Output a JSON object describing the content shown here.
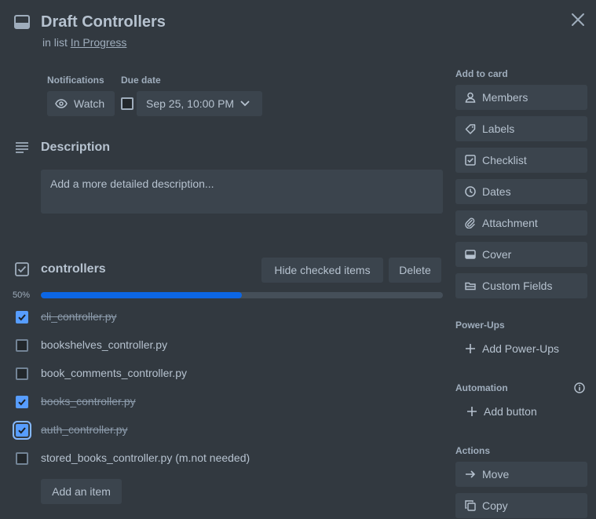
{
  "card": {
    "title": "Draft Controllers",
    "in_list_prefix": "in list",
    "list_name": "In Progress"
  },
  "notifications": {
    "label": "Notifications",
    "watch_label": "Watch"
  },
  "due_date": {
    "label": "Due date",
    "value": "Sep 25, 10:00 PM",
    "checked": false
  },
  "description": {
    "title": "Description",
    "placeholder": "Add a more detailed description..."
  },
  "checklist": {
    "title": "controllers",
    "hide_checked_label": "Hide checked items",
    "delete_label": "Delete",
    "progress_label": "50%",
    "progress": 0.5,
    "items": [
      {
        "text": "cli_controller.py",
        "checked": true
      },
      {
        "text": "bookshelves_controller.py",
        "checked": false
      },
      {
        "text": "book_comments_controller.py",
        "checked": false
      },
      {
        "text": "books_controller.py",
        "checked": true
      },
      {
        "text": "auth_controller.py",
        "checked": true
      },
      {
        "text": "stored_books_controller.py (m.not needed)",
        "checked": false
      }
    ],
    "add_item_label": "Add an item"
  },
  "sidebar": {
    "add_to_card_label": "Add to card",
    "add_to_card": [
      {
        "label": "Members",
        "icon": "person-icon"
      },
      {
        "label": "Labels",
        "icon": "tag-icon"
      },
      {
        "label": "Checklist",
        "icon": "checklist-icon"
      },
      {
        "label": "Dates",
        "icon": "clock-icon"
      },
      {
        "label": "Attachment",
        "icon": "paperclip-icon"
      },
      {
        "label": "Cover",
        "icon": "cover-icon"
      },
      {
        "label": "Custom Fields",
        "icon": "custom-fields-icon"
      }
    ],
    "power_ups_label": "Power-Ups",
    "add_power_ups_label": "Add Power-Ups",
    "automation_label": "Automation",
    "add_button_label": "Add button",
    "actions_label": "Actions",
    "actions": [
      {
        "label": "Move",
        "icon": "arrow-right-icon"
      },
      {
        "label": "Copy",
        "icon": "copy-icon"
      }
    ]
  },
  "colors": {
    "background": "#323940",
    "button": "#3b444d",
    "text": "#b6c2cf",
    "progress_fill": "#0c66e4",
    "checkbox_checked": "#579dff"
  }
}
